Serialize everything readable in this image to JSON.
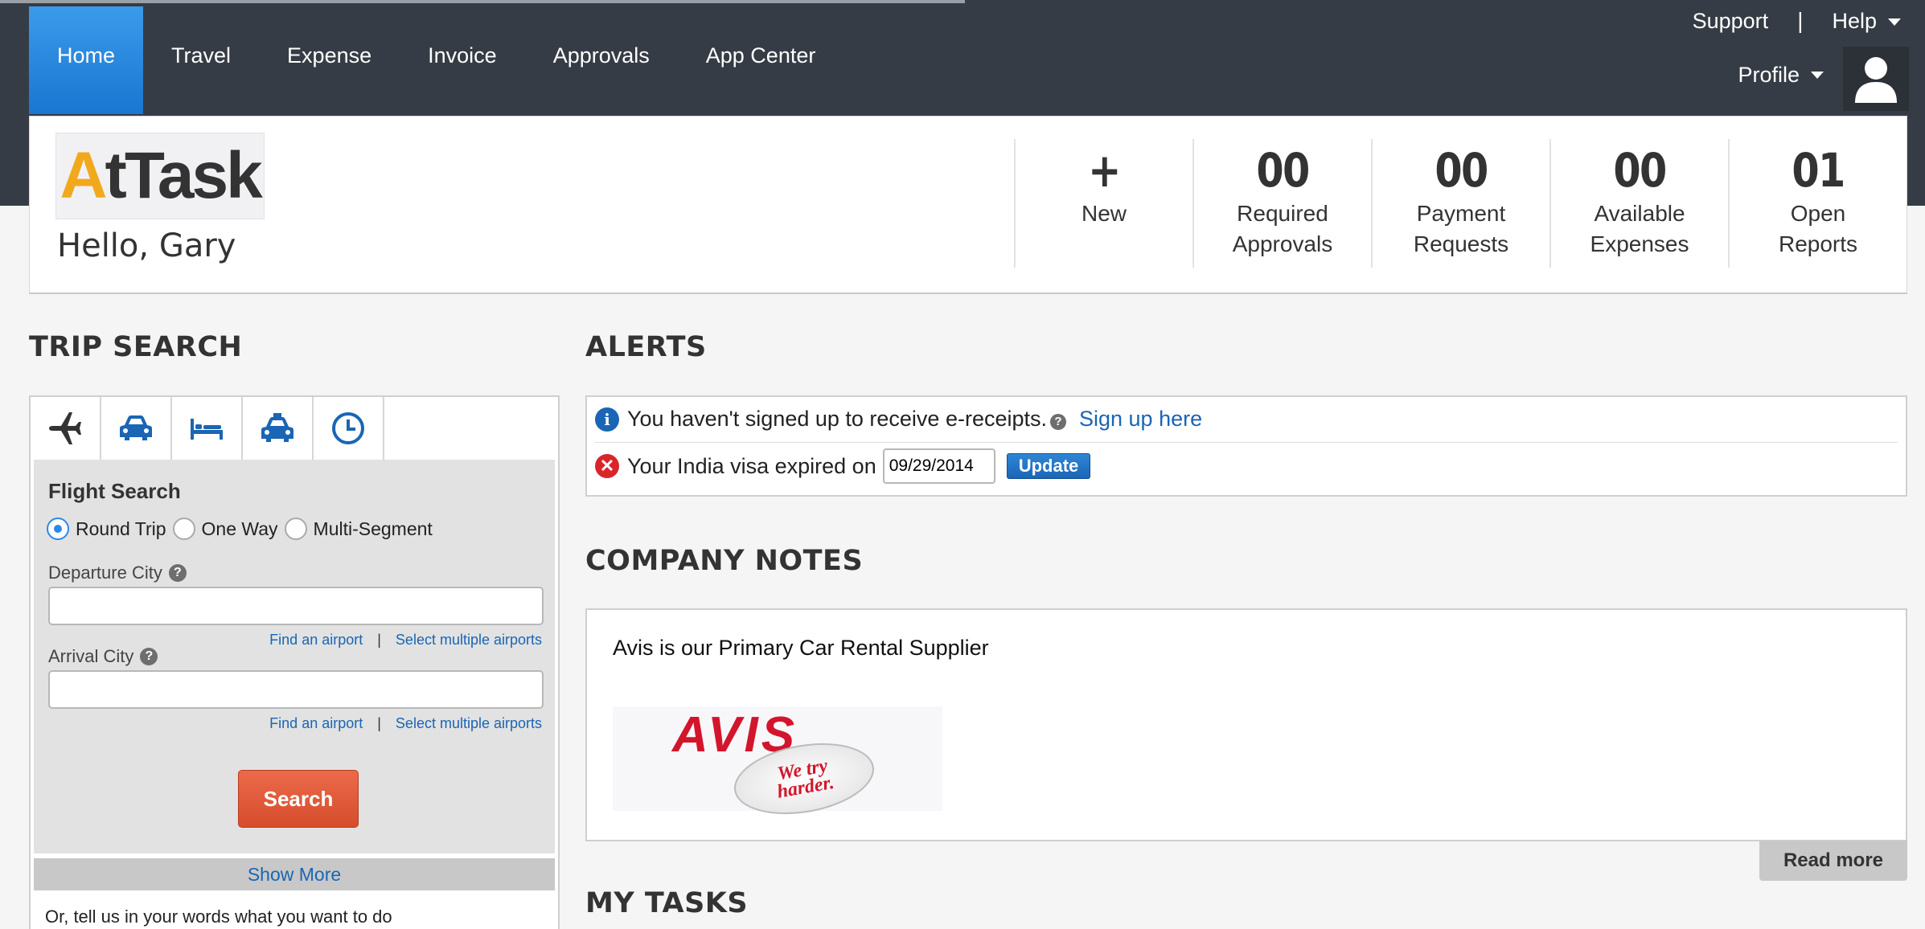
{
  "nav": {
    "items": [
      {
        "label": "Home",
        "active": true
      },
      {
        "label": "Travel",
        "active": false
      },
      {
        "label": "Expense",
        "active": false
      },
      {
        "label": "Invoice",
        "active": false
      },
      {
        "label": "Approvals",
        "active": false
      },
      {
        "label": "App Center",
        "active": false
      }
    ],
    "support_label": "Support",
    "help_label": "Help",
    "profile_label": "Profile"
  },
  "header": {
    "logo_text_first": "A",
    "logo_text_rest": "tTask",
    "greeting": "Hello, Gary",
    "stats": [
      {
        "value": "+",
        "line1": "New",
        "line2": ""
      },
      {
        "value": "00",
        "line1": "Required",
        "line2": "Approvals"
      },
      {
        "value": "00",
        "line1": "Payment",
        "line2": "Requests"
      },
      {
        "value": "00",
        "line1": "Available",
        "line2": "Expenses"
      },
      {
        "value": "01",
        "line1": "Open",
        "line2": "Reports"
      }
    ]
  },
  "trip_search": {
    "title": "TRIP SEARCH",
    "tabs": [
      "airplane-icon",
      "car-icon",
      "bed-icon",
      "taxi-icon",
      "clock-icon"
    ],
    "flight_title": "Flight Search",
    "trip_types": [
      {
        "label": "Round Trip",
        "selected": true
      },
      {
        "label": "One Way",
        "selected": false
      },
      {
        "label": "Multi-Segment",
        "selected": false
      }
    ],
    "departure_label": "Departure City",
    "departure_value": "",
    "arrival_label": "Arrival City",
    "arrival_value": "",
    "find_airport": "Find an airport",
    "select_multiple": "Select multiple airports",
    "search_label": "Search",
    "show_more": "Show More",
    "or_text": "Or, tell us in your words what you want to do"
  },
  "alerts": {
    "title": "ALERTS",
    "ereceipt_text": "You haven't signed up to receive e-receipts.",
    "signup_link": "Sign up here",
    "visa_text": "Your India visa expired on",
    "visa_date": "09/29/2014",
    "update_label": "Update"
  },
  "company_notes": {
    "title": "COMPANY NOTES",
    "text": "Avis is our Primary Car Rental Supplier",
    "avis_logo_word": "AVIS",
    "avis_badge_line1": "We try",
    "avis_badge_line2": "harder.",
    "read_more": "Read more"
  },
  "my_tasks": {
    "title": "MY TASKS"
  },
  "colors": {
    "topbar": "#363c45",
    "active_tab": "#1976d2",
    "link": "#1a65b5",
    "search_button": "#d64d2c",
    "error": "#d9252a"
  }
}
